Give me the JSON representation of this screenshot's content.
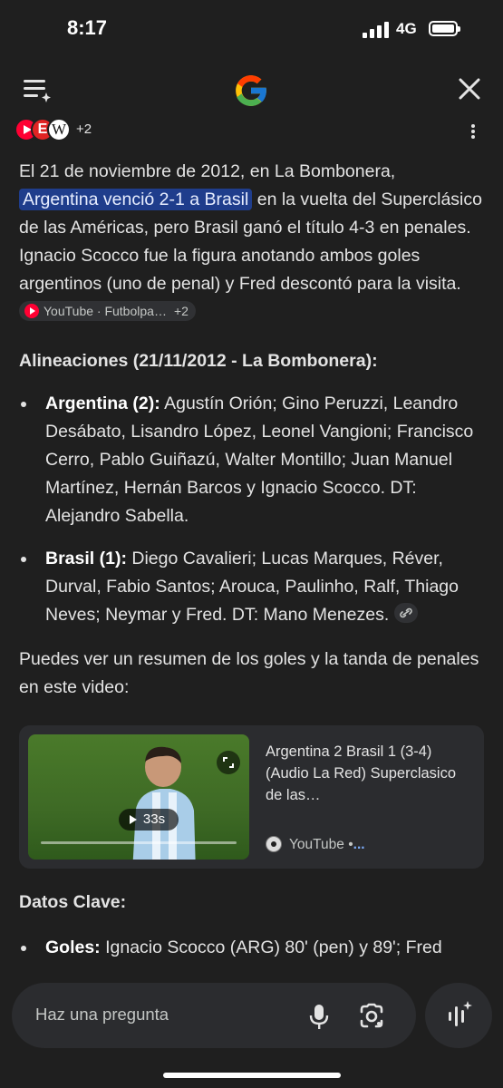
{
  "status": {
    "time": "8:17",
    "network": "4G"
  },
  "header": {
    "logo": "google-g-logo"
  },
  "sources": {
    "more": "+2",
    "icons": [
      "youtube-icon",
      "e-source-icon",
      "wikipedia-icon"
    ]
  },
  "answer": {
    "intro_1": "El 21 de noviembre de 2012, en La Bombonera,",
    "intro_highlight": "Argentina venció 2-1 a Brasil",
    "intro_2": " en la vuelta del Superclásico de las Américas, pero Brasil ganó el título 4-3 en penales. Ignacio Scocco fue la figura anotando ambos goles argentinos (uno de penal) y Fred descontó para la visita.",
    "chip": {
      "label": "YouTube · Futbolpa…",
      "more": "+2"
    },
    "lineups_heading": "Alineaciones (21/11/2012 - La Bombonera):",
    "lineups": [
      {
        "team": "Argentina (2):",
        "players": " Agustín Orión; Gino Peruzzi, Leandro Desábato, Lisandro López, Leonel Vangioni; Francisco Cerro, Pablo Guiñazú, Walter Montillo; Juan Manuel Martínez, Hernán Barcos y Ignacio Scocco. DT: Alejandro Sabella."
      },
      {
        "team": "Brasil (1):",
        "players": " Diego Cavalieri; Lucas Marques, Réver, Durval, Fabio Santos; Arouca, Paulinho, Ralf, Thiago Neves; Neymar y Fred. DT: Mano Menezes."
      }
    ],
    "video_intro": "Puedes ver un resumen de los goles y la tanda de penales en este video:",
    "video": {
      "duration": "33s",
      "title": "Argentina 2 Brasil 1 (3-4) (Audio La Red) Superclasico de las…",
      "source": "YouTube •",
      "more": "..."
    },
    "key_heading": "Datos Clave:",
    "key_items": [
      {
        "label": "Goles:",
        "text": " Ignacio Scocco (ARG) 80' (pen) y 89'; Fred"
      }
    ]
  },
  "input": {
    "placeholder": "Haz una pregunta"
  },
  "colors": {
    "background": "#1f1f1f",
    "highlight": "#1f3d8c",
    "card": "#2b2c2f"
  }
}
